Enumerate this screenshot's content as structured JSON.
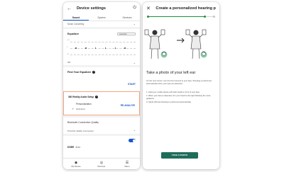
{
  "left_phone": {
    "title": "Device settings",
    "back_icon": "arrow-left-icon",
    "power_icon": "power-icon",
    "tabs": [
      {
        "label": "Sound",
        "active": true
      },
      {
        "label": "System",
        "active": false
      },
      {
        "label": "Services",
        "active": false
      }
    ],
    "noise_row": "Noise Canceling",
    "equalizer": {
      "title": "Equalizer",
      "preset": "Automatic",
      "labels": [
        "+10",
        "0",
        "-10"
      ],
      "mode": "Off"
    },
    "find_equalizer": {
      "title": "Find Your Equalizer",
      "action": "START"
    },
    "reality_audio": {
      "title": "360 Reality Audio Setup",
      "personalization_label": "Personalization",
      "status": "Optimized",
      "action": "RE-ANALYZE"
    },
    "bluetooth": {
      "title": "Bluetooth Connection Quality",
      "value": "Prioritize Stable Connection"
    },
    "dsee": {
      "label": "DSEE",
      "sub": "Auto",
      "enabled": true
    },
    "bottom_nav": [
      {
        "label": "My Device",
        "icon": "headphones-icon"
      },
      {
        "label": "Discover",
        "icon": "discover-icon"
      },
      {
        "label": "Menu",
        "icon": "menu-icon"
      }
    ]
  },
  "right_phone": {
    "title": "Create a personalized hearing pr...",
    "close_icon": "close-icon",
    "progress": 0.85,
    "headline": "Take a photo of your left ear",
    "description": "On the next screen, turn the front camera to your face. Shooting is performed automatically when your ears are detected.",
    "steps": [
      "1. Hold your mobile device with both hands in front of your face.",
      "2. When your face is detected, turn your head to the right following the voice guidance.",
      "3. Stand still and shooting is performed automatically."
    ],
    "button_label": "TAKE A PHOTO"
  },
  "colors": {
    "accent_blue": "#1a56c8",
    "highlight_border": "#f5a582",
    "progress_green": "#1e8e3e",
    "button_teal": "#1e6d5b"
  }
}
